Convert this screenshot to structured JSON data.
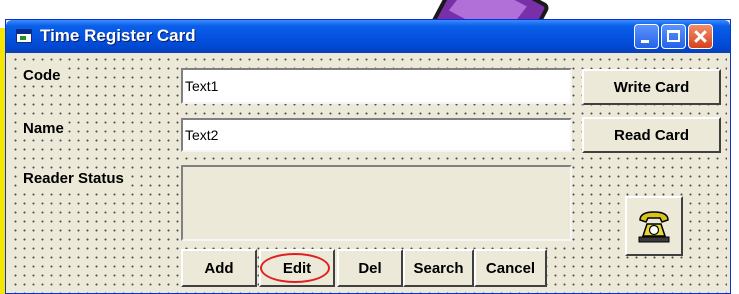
{
  "window": {
    "title": "Time Register Card"
  },
  "form": {
    "code_label": "Code",
    "name_label": "Name",
    "status_label": "Reader Status",
    "code_value": "Text1",
    "name_value": "Text2",
    "status_value": ""
  },
  "buttons": {
    "write_card": "Write Card",
    "read_card": "Read Card",
    "add": "Add",
    "edit": "Edit",
    "del": "Del",
    "search": "Search",
    "cancel": "Cancel"
  },
  "icons": {
    "app": "form-window-icon",
    "reader": "telephone-icon"
  },
  "colors": {
    "titlebar": "#0553e1",
    "form_background": "#ece9d8",
    "edit_highlight": "#e02020",
    "close_button": "#d6421c"
  }
}
